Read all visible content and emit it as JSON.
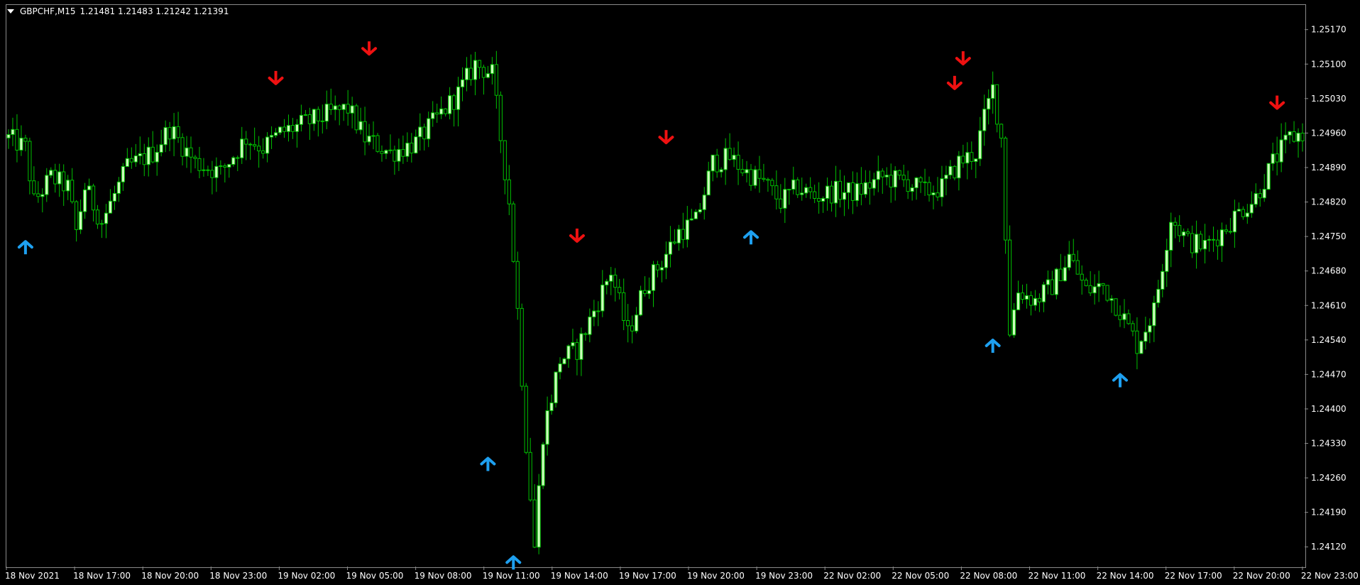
{
  "header": {
    "symbol": "GBPCHF,M15",
    "ohlc": "1.21481 1.21483 1.21242 1.21391"
  },
  "colors": {
    "background": "#000000",
    "bull_body": "#ccffbb",
    "bear_body": "#000000",
    "candle_outline": "#00c000",
    "wick": "#00c000",
    "buy_arrow": "#1ea0f0",
    "sell_arrow": "#ee1111",
    "axis_text": "#ffffff",
    "frame": "#8a8a8a"
  },
  "chart_data": {
    "type": "candlestick",
    "symbol": "GBPCHF",
    "timeframe": "M15",
    "ylim": [
      1.2408,
      1.2522
    ],
    "y_ticks": [
      "1.25170",
      "1.25100",
      "1.25030",
      "1.24960",
      "1.24890",
      "1.24820",
      "1.24750",
      "1.24680",
      "1.24610",
      "1.24540",
      "1.24470",
      "1.24400",
      "1.24330",
      "1.24260",
      "1.24190",
      "1.24120"
    ],
    "x_ticks": [
      "18 Nov 2021",
      "18 Nov 17:00",
      "18 Nov 20:00",
      "18 Nov 23:00",
      "19 Nov 02:00",
      "19 Nov 05:00",
      "19 Nov 08:00",
      "19 Nov 11:00",
      "19 Nov 14:00",
      "19 Nov 17:00",
      "19 Nov 20:00",
      "19 Nov 23:00",
      "22 Nov 02:00",
      "22 Nov 05:00",
      "22 Nov 08:00",
      "22 Nov 11:00",
      "22 Nov 14:00",
      "22 Nov 17:00",
      "22 Nov 20:00",
      "22 Nov 23:00"
    ],
    "close_path": [
      [
        0,
        1.2495
      ],
      [
        4,
        1.2493
      ],
      [
        6,
        1.2482
      ],
      [
        10,
        1.2487
      ],
      [
        14,
        1.2485
      ],
      [
        16,
        1.2476
      ],
      [
        18,
        1.2485
      ],
      [
        22,
        1.2478
      ],
      [
        28,
        1.2489
      ],
      [
        34,
        1.2492
      ],
      [
        38,
        1.2497
      ],
      [
        44,
        1.249
      ],
      [
        50,
        1.2488
      ],
      [
        56,
        1.2495
      ],
      [
        60,
        1.2493
      ],
      [
        64,
        1.2496
      ],
      [
        70,
        1.2498
      ],
      [
        76,
        1.25
      ],
      [
        80,
        1.2501
      ],
      [
        84,
        1.2495
      ],
      [
        90,
        1.2492
      ],
      [
        96,
        1.2494
      ],
      [
        100,
        1.2498
      ],
      [
        106,
        1.2504
      ],
      [
        110,
        1.251
      ],
      [
        114,
        1.2508
      ],
      [
        118,
        1.2482
      ],
      [
        120,
        1.246
      ],
      [
        122,
        1.2433
      ],
      [
        124,
        1.2412
      ],
      [
        126,
        1.2435
      ],
      [
        130,
        1.245
      ],
      [
        134,
        1.2452
      ],
      [
        138,
        1.246
      ],
      [
        142,
        1.2468
      ],
      [
        146,
        1.2455
      ],
      [
        150,
        1.2465
      ],
      [
        154,
        1.247
      ],
      [
        158,
        1.2476
      ],
      [
        162,
        1.2478
      ],
      [
        166,
        1.249
      ],
      [
        170,
        1.2491
      ],
      [
        174,
        1.2488
      ],
      [
        178,
        1.2486
      ],
      [
        182,
        1.2482
      ],
      [
        186,
        1.2485
      ],
      [
        190,
        1.2483
      ],
      [
        194,
        1.2484
      ],
      [
        200,
        1.2484
      ],
      [
        206,
        1.2487
      ],
      [
        212,
        1.2486
      ],
      [
        216,
        1.2484
      ],
      [
        220,
        1.2485
      ],
      [
        224,
        1.249
      ],
      [
        228,
        1.2492
      ],
      [
        230,
        1.2499
      ],
      [
        232,
        1.2505
      ],
      [
        234,
        1.2495
      ],
      [
        236,
        1.2456
      ],
      [
        238,
        1.2464
      ],
      [
        242,
        1.2462
      ],
      [
        246,
        1.2465
      ],
      [
        250,
        1.2471
      ],
      [
        254,
        1.2464
      ],
      [
        258,
        1.2465
      ],
      [
        262,
        1.246
      ],
      [
        266,
        1.2453
      ],
      [
        270,
        1.246
      ],
      [
        274,
        1.2479
      ],
      [
        278,
        1.2474
      ],
      [
        282,
        1.2473
      ],
      [
        286,
        1.2476
      ],
      [
        290,
        1.248
      ],
      [
        294,
        1.2483
      ],
      [
        298,
        1.249
      ],
      [
        302,
        1.2495
      ],
      [
        305,
        1.2496
      ]
    ],
    "total_bars": 306,
    "signals": [
      {
        "type": "buy",
        "bar": 4,
        "price": 1.2476
      },
      {
        "type": "sell",
        "bar": 63,
        "price": 1.2504
      },
      {
        "type": "sell",
        "bar": 85,
        "price": 1.251
      },
      {
        "type": "buy",
        "bar": 113,
        "price": 1.2432
      },
      {
        "type": "buy",
        "bar": 119,
        "price": 1.2412
      },
      {
        "type": "sell",
        "bar": 134,
        "price": 1.2472
      },
      {
        "type": "sell",
        "bar": 155,
        "price": 1.2492
      },
      {
        "type": "buy",
        "bar": 175,
        "price": 1.2478
      },
      {
        "type": "sell",
        "bar": 223,
        "price": 1.2503
      },
      {
        "type": "sell",
        "bar": 225,
        "price": 1.2508
      },
      {
        "type": "buy",
        "bar": 232,
        "price": 1.2456
      },
      {
        "type": "buy",
        "bar": 262,
        "price": 1.2449
      },
      {
        "type": "sell",
        "bar": 299,
        "price": 1.2499
      }
    ]
  }
}
